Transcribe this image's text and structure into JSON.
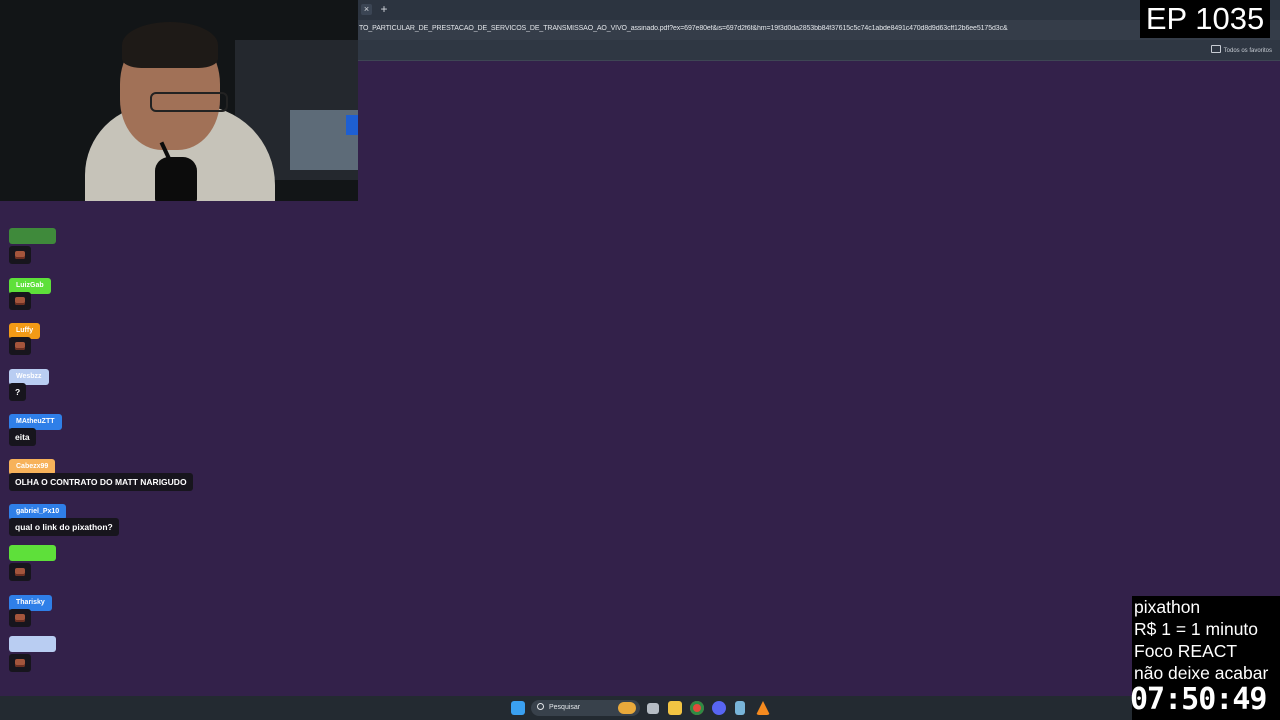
{
  "browser": {
    "url": "TO_PARTICULAR_DE_PRESTACAO_DE_SERVICOS_DE_TRANSMISSAO_AO_VIVO_assinado.pdf?ex=697e80ef&is=697d2f6f&hm=19f3d0da2853bb84f37615c5c74c1abde8491c470d8d9d63cff12b6ee5175d3c&",
    "tab_close": "×",
    "tab_new": "+",
    "bookmarks_all": "Todos os favoritos"
  },
  "overlay": {
    "episode": "EP 1035",
    "lines": [
      "pixathon",
      "R$ 1 = 1 minuto",
      "Foco REACT",
      "não deixe acabar"
    ],
    "timer": "07:50:49"
  },
  "chat": [
    {
      "user": "",
      "color": "#3f8a3b",
      "text": "",
      "emote": "brick-emote"
    },
    {
      "user": "LuizGab",
      "color": "#5ee03a",
      "text": "",
      "emote": "brick-emote"
    },
    {
      "user": "Luffy",
      "color": "#f29a16",
      "text": "",
      "emote": "brick-emote"
    },
    {
      "user": "Wesbzz",
      "color": "#b9cdf2",
      "text": "?",
      "emote": ""
    },
    {
      "user": "MAtheuZTT",
      "color": "#2f7fe8",
      "text": "eita",
      "emote": ""
    },
    {
      "user": "Cabezx99",
      "color": "#f7b25a",
      "text": "OLHA O CONTRATO DO MATT NARIGUDO",
      "emote": ""
    },
    {
      "user": "gabriel_Px10",
      "color": "#2f7fe8",
      "text": "qual o link do pixathon?",
      "emote": ""
    },
    {
      "user": "",
      "color": "#5ee03a",
      "text": "",
      "emote": "brick-emote"
    },
    {
      "user": "Tharisky",
      "color": "#2f7fe8",
      "text": "",
      "emote": "brick-emote"
    },
    {
      "user": "",
      "color": "#b9cdf2",
      "text": "",
      "emote": "brick-emote"
    }
  ],
  "taskbar": {
    "search_placeholder": "Pesquisar",
    "icons": [
      "windows-start-icon",
      "widgets-icon",
      "task-view-icon",
      "file-explorer-icon",
      "chrome-icon",
      "discord-icon",
      "notepad-icon",
      "vlc-icon"
    ]
  }
}
